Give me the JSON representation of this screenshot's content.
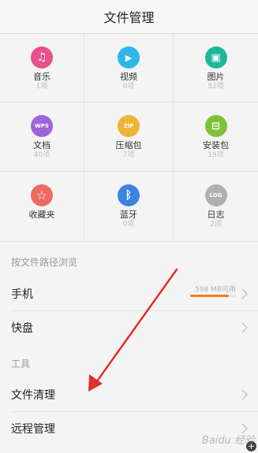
{
  "header": {
    "title": "文件管理"
  },
  "categories": [
    {
      "label": "音乐",
      "count": "1项",
      "icon": "music-icon",
      "glyph": "♫",
      "color": "#e7528b"
    },
    {
      "label": "视频",
      "count": "0项",
      "icon": "video-icon",
      "glyph": "▶",
      "color": "#2fb5e7"
    },
    {
      "label": "图片",
      "count": "52项",
      "icon": "picture-icon",
      "glyph": "▣",
      "color": "#1bb999"
    },
    {
      "label": "文档",
      "count": "40项",
      "icon": "document-icon",
      "glyph": "WPS",
      "color": "#9e65d8"
    },
    {
      "label": "压缩包",
      "count": "7项",
      "icon": "zip-icon",
      "glyph": "ZIP",
      "color": "#efb33a"
    },
    {
      "label": "安装包",
      "count": "19项",
      "icon": "apk-icon",
      "glyph": "⊟",
      "color": "#7fc23a"
    },
    {
      "label": "收藏夹",
      "count": "",
      "icon": "star-icon",
      "glyph": "☆",
      "color": "#ec6c5f"
    },
    {
      "label": "蓝牙",
      "count": "0项",
      "icon": "bluetooth-icon",
      "glyph": "ᛒ",
      "color": "#3b84e6"
    },
    {
      "label": "日志",
      "count": "2项",
      "icon": "log-icon",
      "glyph": "LOG",
      "color": "#b0b0b0"
    }
  ],
  "browse": {
    "section_label": "按文件路径浏览",
    "phone_label": "手机",
    "phone_storage": "598 MB可用",
    "phone_storage_fraction": 0.85,
    "cloud_label": "快盘"
  },
  "tools": {
    "section_label": "工具",
    "clean_label": "文件清理",
    "remote_label": "远程管理"
  },
  "watermark": "Baidu 经验",
  "colors": {
    "storage_bar": "#f07a28",
    "arrow": "#e0302a"
  }
}
